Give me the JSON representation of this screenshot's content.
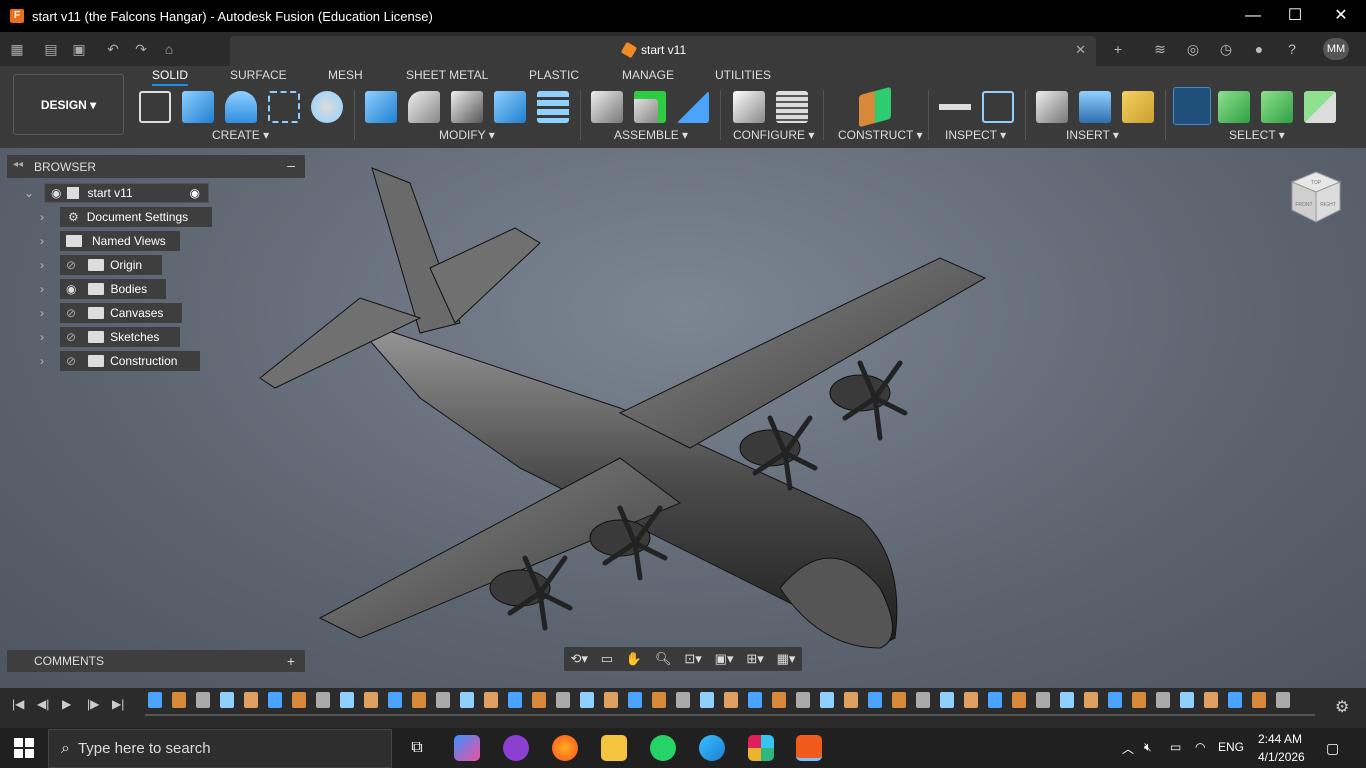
{
  "window": {
    "title": "start v11 (the Falcons Hangar) - Autodesk Fusion (Education License)",
    "minimize": "—",
    "maximize": "☐",
    "close": "✕"
  },
  "document_tab": {
    "name": "start v11",
    "close": "✕"
  },
  "user": {
    "initials": "MM"
  },
  "workspace": {
    "label": "DESIGN ▾"
  },
  "ribbon_tabs": [
    "SOLID",
    "SURFACE",
    "MESH",
    "SHEET METAL",
    "PLASTIC",
    "MANAGE",
    "UTILITIES"
  ],
  "ribbon_groups": [
    "CREATE ▾",
    "MODIFY ▾",
    "ASSEMBLE ▾",
    "CONFIGURE ▾",
    "CONSTRUCT ▾",
    "INSPECT ▾",
    "INSERT ▾",
    "SELECT ▾"
  ],
  "browser": {
    "title": "BROWSER",
    "root": "start v11",
    "nodes": [
      "Document Settings",
      "Named Views",
      "Origin",
      "Bodies",
      "Canvases",
      "Sketches",
      "Construction"
    ]
  },
  "comments": {
    "title": "COMMENTS",
    "add": "+"
  },
  "viewcube": {
    "top": "TOP",
    "front": "FRONT",
    "right": "RIGHT"
  },
  "taskbar": {
    "search_placeholder": "Type here to search",
    "lang": "ENG",
    "time": "2:44 AM",
    "date": "4/1/2026"
  },
  "colors": {
    "accent": "#1a8fe3",
    "fusion_orange": "#f08a24",
    "titlebar": "#000000"
  }
}
